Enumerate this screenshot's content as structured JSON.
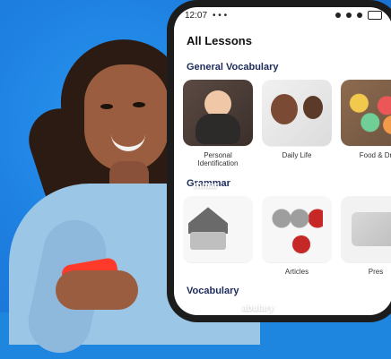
{
  "status_bar": {
    "time": "12:07",
    "dots": "• • •"
  },
  "lessons": {
    "title": "All Lessons",
    "sections": [
      {
        "title": "General Vocabulary"
      },
      {
        "title": "Grammar"
      },
      {
        "title": "Vocabulary"
      }
    ],
    "general_vocabulary": [
      {
        "label": "Personal\nIdentification"
      },
      {
        "label": "Daily Life"
      },
      {
        "label": "Food & Dr"
      }
    ],
    "grammar": [
      {
        "label": ""
      },
      {
        "label": "Articles"
      },
      {
        "label": "Pres"
      }
    ]
  },
  "overlays": {
    "grammar_cut": "mmar",
    "vocab_cut": "abulary"
  }
}
